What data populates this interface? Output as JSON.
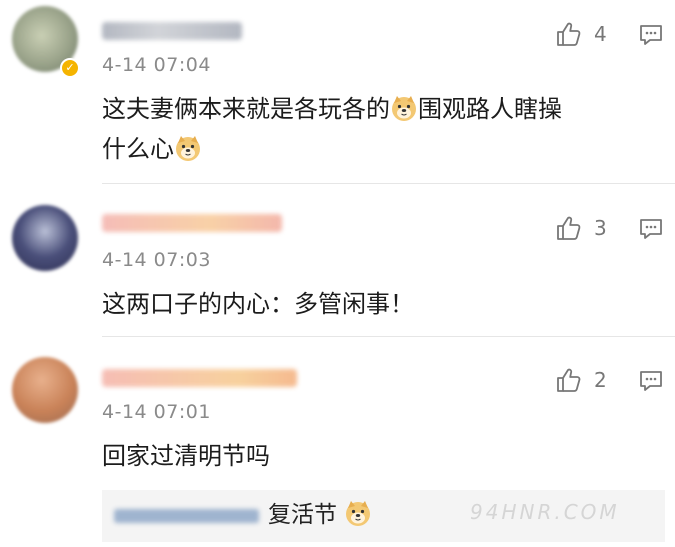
{
  "comments": [
    {
      "time": "4-14 07:04",
      "text_parts": [
        "这夫妻俩本来就是各玩各的",
        "围观路人瞎操",
        "什么心"
      ],
      "likes": "4",
      "verified": true
    },
    {
      "time": "4-14 07:03",
      "text": "这两口子的内心：多管闲事！",
      "likes": "3"
    },
    {
      "time": "4-14 07:01",
      "text": "回家过清明节吗",
      "likes": "2",
      "reply": {
        "text": "复活节"
      }
    }
  ],
  "icons": {
    "like": "thumbs-up-icon",
    "reply": "comment-icon",
    "emoji": "doge-emoji-icon",
    "verified": "verified-badge-icon"
  },
  "colors": {
    "time": "#8a8a8a",
    "divider": "#e6e6e6",
    "verified": "#f5b400",
    "reply_bg": "#f4f4f4"
  },
  "watermark": "94HNR.COM"
}
